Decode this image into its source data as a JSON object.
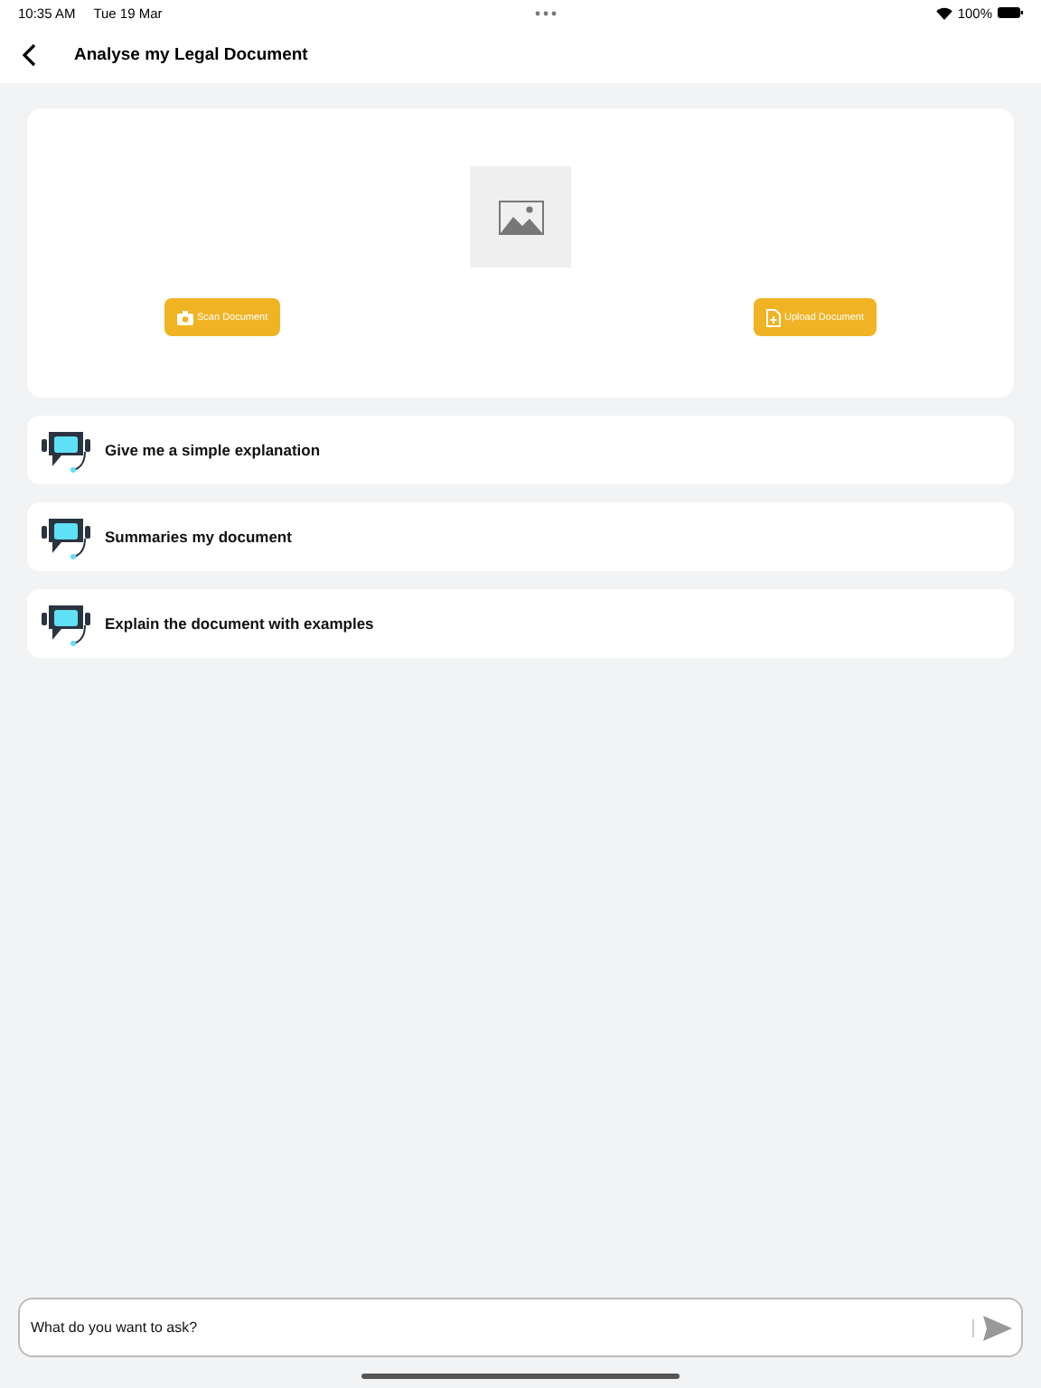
{
  "status_bar": {
    "time": "10:35 AM",
    "date": "Tue 19 Mar",
    "battery": "100%"
  },
  "header": {
    "title": "Analyse my Legal Document"
  },
  "upload_card": {
    "buttons": [
      {
        "label": "Scan Document",
        "kind": "scan"
      },
      {
        "label": "Upload Document",
        "kind": "upload"
      }
    ]
  },
  "prompts": [
    {
      "label": "Give me a simple explanation"
    },
    {
      "label": "Summaries my document"
    },
    {
      "label": "Explain the document with examples"
    }
  ],
  "input": {
    "placeholder": "What do you want to ask?"
  }
}
